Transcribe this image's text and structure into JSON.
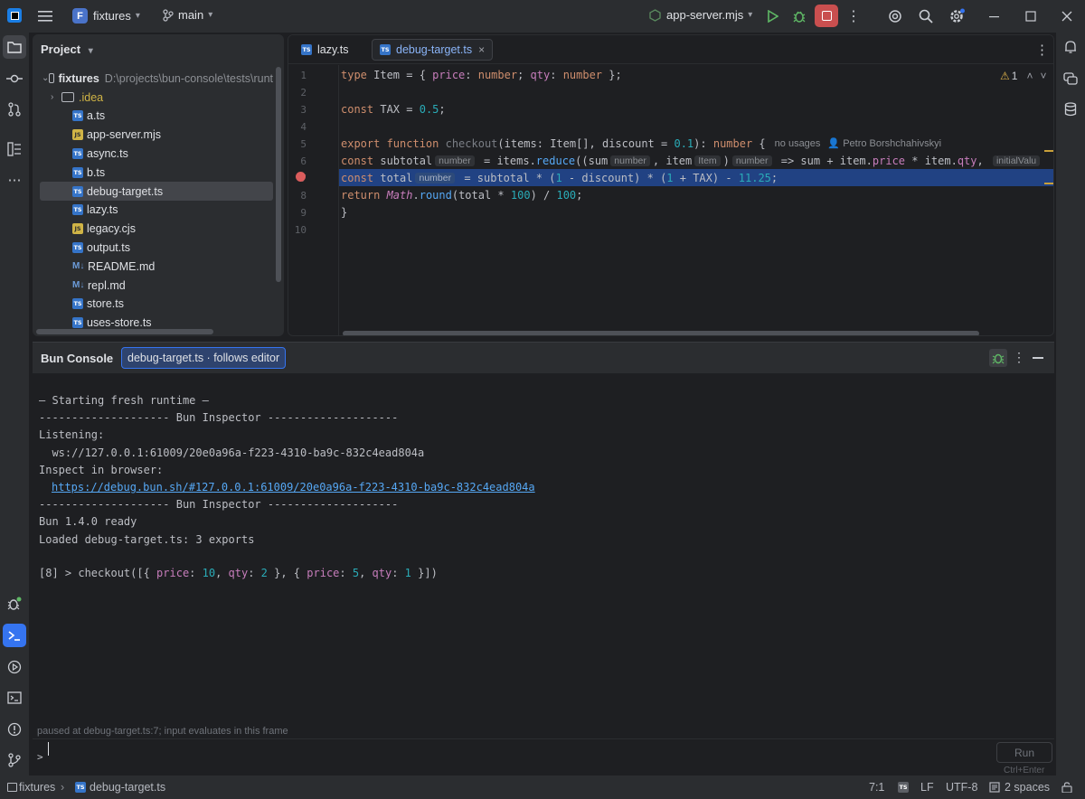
{
  "titlebar": {
    "project_badge": "F",
    "project_name": "fixtures",
    "branch": "main",
    "run_config": "app-server.mjs"
  },
  "project_panel": {
    "title": "Project",
    "root_name": "fixtures",
    "root_path": "D:\\projects\\bun-console\\tests\\runt",
    "items": [
      {
        "name": ".idea",
        "kind": "folder"
      },
      {
        "name": "a.ts",
        "kind": "ts"
      },
      {
        "name": "app-server.mjs",
        "kind": "js"
      },
      {
        "name": "async.ts",
        "kind": "ts"
      },
      {
        "name": "b.ts",
        "kind": "ts"
      },
      {
        "name": "debug-target.ts",
        "kind": "ts",
        "selected": true
      },
      {
        "name": "lazy.ts",
        "kind": "ts"
      },
      {
        "name": "legacy.cjs",
        "kind": "js"
      },
      {
        "name": "output.ts",
        "kind": "ts"
      },
      {
        "name": "README.md",
        "kind": "md"
      },
      {
        "name": "repl.md",
        "kind": "md"
      },
      {
        "name": "store.ts",
        "kind": "ts"
      },
      {
        "name": "uses-store.ts",
        "kind": "ts"
      }
    ]
  },
  "editor": {
    "tabs": [
      {
        "label": "lazy.ts",
        "active": false
      },
      {
        "label": "debug-target.ts",
        "active": true
      }
    ],
    "line_numbers": [
      "1",
      "2",
      "3",
      "4",
      "5",
      "6",
      "7",
      "8",
      "9",
      "10"
    ],
    "warning_count": "1",
    "hints": {
      "no_usages": "no usages",
      "author": "Petro Borshchahivskyi",
      "number": "number",
      "item": "Item",
      "initial_value": "initialValu"
    }
  },
  "console": {
    "title": "Bun Console",
    "badge": "debug-target.ts · follows editor",
    "output": [
      "— Starting fresh runtime —",
      "-------------------- Bun Inspector --------------------",
      "Listening:",
      "  ws://127.0.0.1:61009/20e0a96a-f223-4310-ba9c-832c4ead804a",
      "Inspect in browser:",
      "https://debug.bun.sh/#127.0.0.1:61009/20e0a96a-f223-4310-ba9c-832c4ead804a",
      "-------------------- Bun Inspector --------------------",
      "Bun 1.4.0 ready",
      "Loaded debug-target.ts: 3 exports"
    ],
    "command_prefix": "[8] > checkout([{ ",
    "command": {
      "price1": "10",
      "qty1": "2",
      "price2": "5",
      "qty2": "1"
    },
    "status_hint": "paused at debug-target.ts:7; input evaluates in this frame",
    "prompt": ">",
    "run_label": "Run",
    "run_shortcut": "Ctrl+Enter"
  },
  "statusbar": {
    "crumb_root": "fixtures",
    "crumb_file": "debug-target.ts",
    "position": "7:1",
    "line_ending": "LF",
    "encoding": "UTF-8",
    "indent": "2 spaces"
  },
  "colors": {
    "accent": "#3574f0",
    "stop": "#c94f4f",
    "run_green": "#5fb865"
  }
}
